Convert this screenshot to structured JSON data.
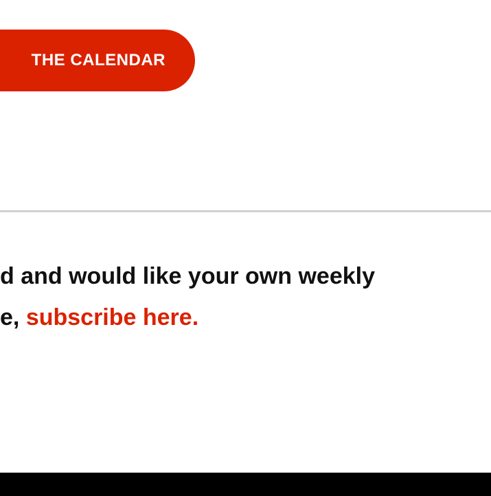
{
  "cta": {
    "label": "THE CALENDAR"
  },
  "subscribe": {
    "line_one": "d and would like your own weekly",
    "line_two_prefix": "e, ",
    "link_label": "subscribe here."
  },
  "colors": {
    "accent": "#db2200",
    "text": "#111111",
    "divider": "#d0d0d0",
    "footer": "#000000"
  }
}
